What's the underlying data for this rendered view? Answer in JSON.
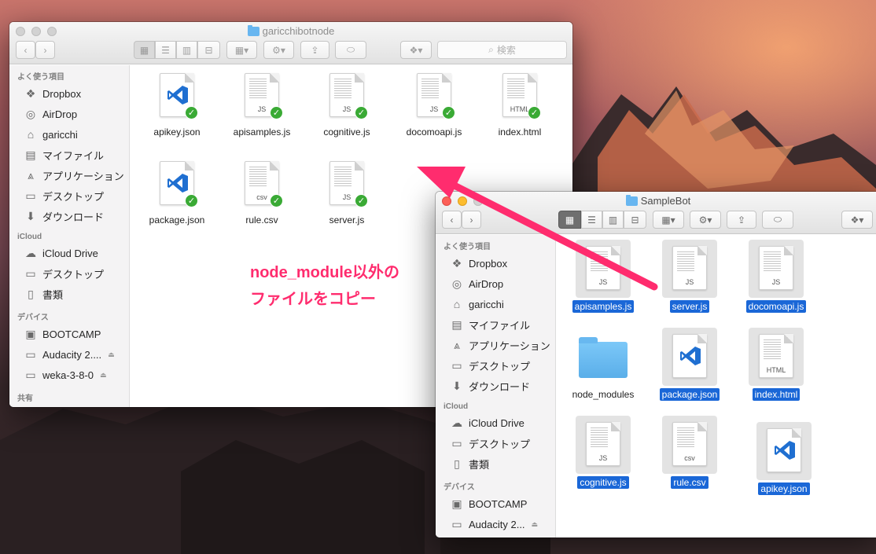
{
  "window1": {
    "title": "garicchibotnode",
    "search_placeholder": "検索",
    "sidebar": {
      "favorites_header": "よく使う項目",
      "favorites": [
        "Dropbox",
        "AirDrop",
        "garicchi",
        "マイファイル",
        "アプリケーション",
        "デスクトップ",
        "ダウンロード"
      ],
      "icloud_header": "iCloud",
      "icloud": [
        "iCloud Drive",
        "デスクトップ",
        "書類"
      ],
      "devices_header": "デバイス",
      "devices": [
        "BOOTCAMP",
        "Audacity 2....",
        "weka-3-8-0"
      ],
      "shared_header": "共有"
    },
    "files": [
      {
        "name": "apikey.json",
        "type": "vs",
        "ext": ""
      },
      {
        "name": "apisamples.js",
        "type": "doc",
        "ext": "JS"
      },
      {
        "name": "cognitive.js",
        "type": "doc",
        "ext": "JS"
      },
      {
        "name": "docomoapi.js",
        "type": "doc",
        "ext": "JS"
      },
      {
        "name": "index.html",
        "type": "doc",
        "ext": "HTML"
      },
      {
        "name": "package.json",
        "type": "vs",
        "ext": ""
      },
      {
        "name": "rule.csv",
        "type": "doc",
        "ext": "csv"
      },
      {
        "name": "server.js",
        "type": "doc",
        "ext": "JS"
      }
    ],
    "check_glyph": "✓"
  },
  "window2": {
    "title": "SampleBot",
    "sidebar": {
      "favorites_header": "よく使う項目",
      "favorites": [
        "Dropbox",
        "AirDrop",
        "garicchi",
        "マイファイル",
        "アプリケーション",
        "デスクトップ",
        "ダウンロード"
      ],
      "icloud_header": "iCloud",
      "icloud": [
        "iCloud Drive",
        "デスクトップ",
        "書類"
      ],
      "devices_header": "デバイス",
      "devices": [
        "BOOTCAMP",
        "Audacity 2..."
      ]
    },
    "files": [
      {
        "name": "apisamples.js",
        "type": "doc",
        "ext": "JS"
      },
      {
        "name": "server.js",
        "type": "doc",
        "ext": "JS"
      },
      {
        "name": "docomoapi.js",
        "type": "doc",
        "ext": "JS"
      },
      {
        "name": "node_modules",
        "type": "folder",
        "ext": ""
      },
      {
        "name": "package.json",
        "type": "vs",
        "ext": ""
      },
      {
        "name": "index.html",
        "type": "doc",
        "ext": "HTML"
      },
      {
        "name": "cognitive.js",
        "type": "doc",
        "ext": "JS"
      },
      {
        "name": "rule.csv",
        "type": "doc",
        "ext": "csv"
      },
      {
        "name": "apikey.json",
        "type": "vs",
        "ext": ""
      }
    ]
  },
  "annotation": {
    "line1": "node_module以外の",
    "line2": "ファイルをコピー",
    "color": "#ff2c6e"
  }
}
